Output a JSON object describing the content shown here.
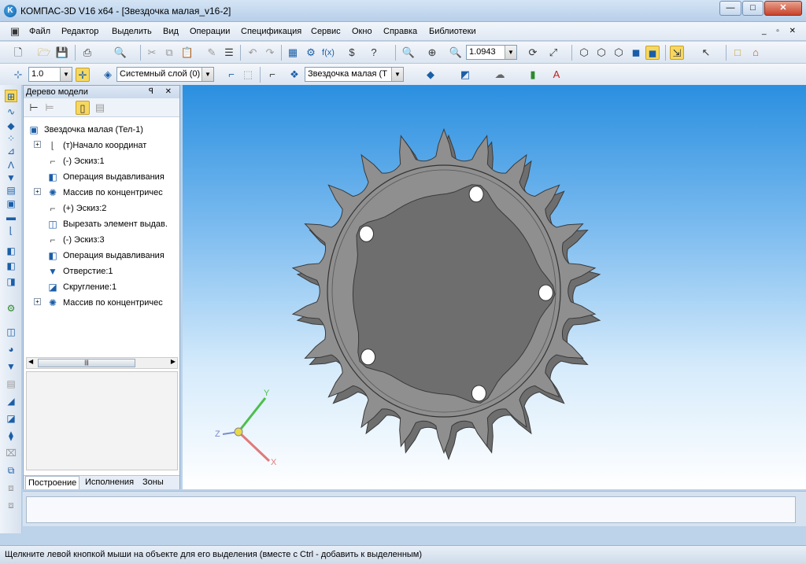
{
  "window": {
    "title": "КОМПАС-3D V16  x64 - [Звездочка малая_v16-2]",
    "app_icon": "kompas-logo",
    "controls": [
      "—",
      "□",
      "✕"
    ]
  },
  "menu": {
    "items": [
      "Файл",
      "Редактор",
      "Выделить",
      "Вид",
      "Операции",
      "Спецификация",
      "Сервис",
      "Окно",
      "Справка",
      "Библиотеки"
    ],
    "mdi_controls": "_ ▫ ✕"
  },
  "toolbar1": {
    "zoom_value": "1.0943"
  },
  "toolbar2": {
    "step_value": "1.0",
    "layer_value": "Системный слой (0)",
    "part_value": "Звездочка малая (Т"
  },
  "tree": {
    "panel_title": "Дерево модели",
    "panel_buttons": "ꟼ ✕",
    "root": "Звездочка малая (Тел-1)",
    "items": [
      {
        "label": "(т)Начало координат",
        "icon": "origin-icon"
      },
      {
        "label": "(-) Эскиз:1",
        "icon": "sketch-icon"
      },
      {
        "label": "Операция выдавливания",
        "icon": "extrude-icon"
      },
      {
        "label": "Массив по концентричес",
        "icon": "circular-array-icon"
      },
      {
        "label": "(+) Эскиз:2",
        "icon": "sketch-icon"
      },
      {
        "label": "Вырезать элемент выдав.",
        "icon": "cut-extrude-icon"
      },
      {
        "label": "(-) Эскиз:3",
        "icon": "sketch-icon"
      },
      {
        "label": "Операция выдавливания",
        "icon": "extrude-icon"
      },
      {
        "label": "Отверстие:1",
        "icon": "hole-icon"
      },
      {
        "label": "Скругление:1",
        "icon": "fillet-icon"
      },
      {
        "label": "Массив по концентричес",
        "icon": "circular-array-icon"
      }
    ],
    "scroll_grip": "|||",
    "tabs": [
      "Построение",
      "Исполнения",
      "Зоны"
    ]
  },
  "axes": {
    "x_label": "X",
    "y_label": "Y",
    "z_label": "Z"
  },
  "colors": {
    "viewport_top": "#2a8fe0",
    "viewport_bottom": "#ffffff",
    "part_fill": "#8f8f8f",
    "part_edge": "#3a3a3a"
  },
  "status": {
    "text": "Щелкните левой кнопкой мыши на объекте для его выделения (вместе с Ctrl - добавить к выделенным)"
  }
}
